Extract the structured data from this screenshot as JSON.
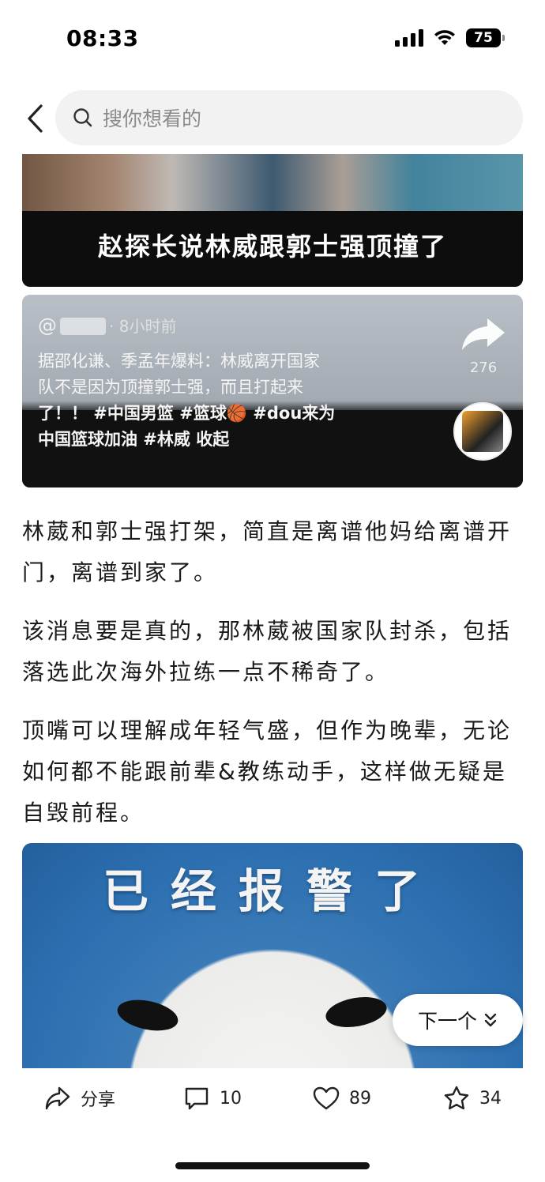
{
  "status_bar": {
    "time": "08:33",
    "battery": "75"
  },
  "search": {
    "placeholder": "搜你想看的"
  },
  "article": {
    "image1_caption": "赵探长说林威跟郭士强顶撞了",
    "embedded_post": {
      "username_prefix": "@",
      "time_ago": "· 8小时前",
      "text_line1": "据邵化谦、季孟年爆料：林威离开国家",
      "text_line2": "队不是因为顶撞郭士强，而且打起来",
      "text_line3": "了！！ #中国男篮 #篮球🏀 #dou来为",
      "text_line4": "中国篮球加油 #林威  收起",
      "share_count": "276"
    },
    "paragraphs": [
      "林葳和郭士强打架，简直是离谱他妈给离谱开门，离谱到家了。",
      "该消息要是真的，那林葳被国家队封杀，包括落选此次海外拉练一点不稀奇了。",
      "顶嘴可以理解成年轻气盛，但作为晚辈，无论如何都不能跟前辈&教练动手，这样做无疑是自毁前程。"
    ],
    "image3_caption": "已经报警了"
  },
  "next_button": {
    "label": "下一个"
  },
  "bottom_bar": {
    "share_label": "分享",
    "comment_count": "10",
    "like_count": "89",
    "favorite_count": "34"
  },
  "colors": {
    "text": "#1a1a1a",
    "search_bg": "#f2f2f2",
    "placeholder": "#8a8a8a"
  }
}
